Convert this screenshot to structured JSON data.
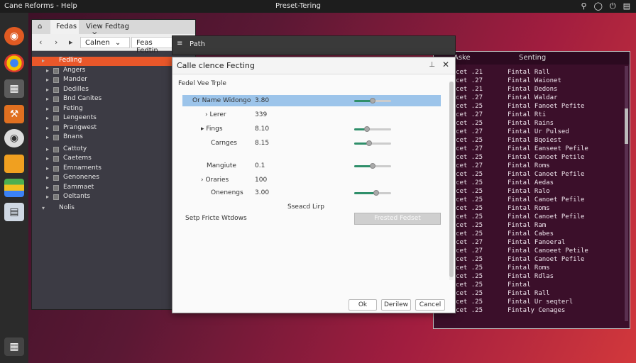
{
  "topbar": {
    "app_title": "Cane Reforms - Help",
    "center_title": "Preset-Tering",
    "tray_icons": [
      "search-icon",
      "user-icon",
      "power-icon",
      "menu-icon"
    ]
  },
  "launcher": {
    "icons": [
      "ubuntu-icon",
      "chrome-icon",
      "calculator-icon",
      "tools-icon",
      "disc-icon",
      "folder-icon",
      "stack-icon",
      "document-icon"
    ],
    "bottom_icon": "apps-grid-icon"
  },
  "file_window": {
    "tabs": [
      {
        "label": "Fedas"
      },
      {
        "label": "View  Fedtag"
      }
    ],
    "tab_close": "×",
    "home_glyph": "⌂",
    "back": "‹",
    "forward": "›",
    "next": "▸",
    "path1": "Calnen",
    "path_dropdown": "⌄",
    "path2": "Feas Fedtin",
    "tree": [
      {
        "label": "Fedling",
        "selected": true,
        "exp": "▸",
        "top": true
      },
      {
        "label": "Angers",
        "exp": "▸"
      },
      {
        "label": "Mander",
        "exp": "▸"
      },
      {
        "label": "Dedilles",
        "exp": "▸"
      },
      {
        "label": "Bnd Canites",
        "exp": "▸"
      },
      {
        "label": "Feting",
        "exp": "▸"
      },
      {
        "label": "Lengeents",
        "exp": "▸"
      },
      {
        "label": "Prangwest",
        "exp": "▸"
      },
      {
        "label": "Bnans",
        "exp": "▸"
      },
      {
        "label": "Cattoty",
        "exp": "▸"
      },
      {
        "label": "Caetems",
        "exp": "▸"
      },
      {
        "label": "Emnaments",
        "exp": "▸"
      },
      {
        "label": "Genonenes",
        "exp": "▸"
      },
      {
        "label": "Eammaet",
        "exp": "▸"
      },
      {
        "label": "Oeltants",
        "exp": "▸"
      },
      {
        "label": "Nolis",
        "exp": "▾",
        "top": true
      }
    ]
  },
  "terminal": {
    "col1": "Aske",
    "col2": "Senting",
    "rows": [
      {
        "a": "Aa, Ucet .21",
        "b": "Fintal Rall"
      },
      {
        "a": "Aa, Ucet .27",
        "b": "Fintal Waionet"
      },
      {
        "a": "Aa, Ucet .21",
        "b": "Fintal Dedons"
      },
      {
        "a": "Aa, Ucet .27",
        "b": "Fintal Waldar"
      },
      {
        "a": "Aa, Ucet .25",
        "b": "Fintal Fanoet Pefite"
      },
      {
        "a": "Aa, Ucet .27",
        "b": "Fintal Rti"
      },
      {
        "a": "Aa, Ucet .25",
        "b": "Fintal Rains"
      },
      {
        "a": "Aa, Ucet .27",
        "b": "Fintal Ur Pulsed"
      },
      {
        "a": "Aa, Ucet .25",
        "b": "Fintal Bqoiest"
      },
      {
        "a": "Aa, Ucet .27",
        "b": "Fintal Eanseet Pefile"
      },
      {
        "a": "Aa, Ucet .25",
        "b": "Fintal Canoet Petile"
      },
      {
        "a": "Aa, Ucet .27",
        "b": "Fintal Roms"
      },
      {
        "a": "Aa, Ucet .25",
        "b": "Fintal Canoet Pefile"
      },
      {
        "a": "Aa, Ucet .25",
        "b": "Fintal Aedas"
      },
      {
        "a": "Aa, Ucet .25",
        "b": "Fintal Ralo"
      },
      {
        "a": "Aa, Ucet .25",
        "b": "Fintal Canoet Pefile"
      },
      {
        "a": "Aa, Ucet .25",
        "b": "Fintal Roms"
      },
      {
        "a": "Aa, Ucet .25",
        "b": "Fintal Canoet Pefile"
      },
      {
        "a": "Aa, Ucet .25",
        "b": "Fintal Ram"
      },
      {
        "a": "Aa, Ucet .25",
        "b": "Fintal Cabes"
      },
      {
        "a": "Aa, Ucet .27",
        "b": "Fintal Fanoeral"
      },
      {
        "a": "Aa, Ucet .27",
        "b": "Fintal Canoeet Petile"
      },
      {
        "a": "Aa, Ucet .25",
        "b": "Fintal Canoet Pefile"
      },
      {
        "a": "Aa, Ucet .25",
        "b": "Fintal Roms"
      },
      {
        "a": "Aa, Ucet .25",
        "b": "Fintal Rdlas"
      },
      {
        "a": "Aa, Ucet .25",
        "b": "Fintal"
      },
      {
        "a": "Aa, Ucet .25",
        "b": "Fintal Rall"
      },
      {
        "a": "Aa, Ucet .25",
        "b": "Fintal Ur seqterl"
      },
      {
        "a": "Aa, Ucet .25",
        "b": "Fintaly Cenages"
      }
    ]
  },
  "back_window": {
    "title": "Path",
    "glyph": "≡"
  },
  "dialog": {
    "title": "Calle clence Fecting",
    "pin_glyph": "⊥",
    "close_glyph": "✕",
    "section": "Fedel Vee Trple",
    "options": [
      {
        "name": "Or Name Widongo",
        "value": "3.80",
        "level": 0.5,
        "highlight": true,
        "indent": 0
      },
      {
        "name": "› Lerer",
        "value": "339",
        "level": null,
        "indent": 1
      },
      {
        "name": "▸ Fings",
        "value": "8.10",
        "level": 0.35,
        "indent": 1
      },
      {
        "name": "Carnges",
        "value": "8.15",
        "level": 0.4,
        "indent": 2
      },
      {
        "name": "Mangiute",
        "value": "0.1",
        "level": 0.5,
        "indent": 1
      },
      {
        "name": "› Oraries",
        "value": "100",
        "level": null,
        "indent": 1
      },
      {
        "name": "Onenengs",
        "value": "3.00",
        "level": 0.6,
        "indent": 2
      }
    ],
    "search_label": "Sseacd Lirp",
    "setup_label": "Setp Fricte Wtdows",
    "default_button": "Frested Fedset",
    "ok": "Ok",
    "review": "Derilew",
    "cancel": "Cancel"
  }
}
